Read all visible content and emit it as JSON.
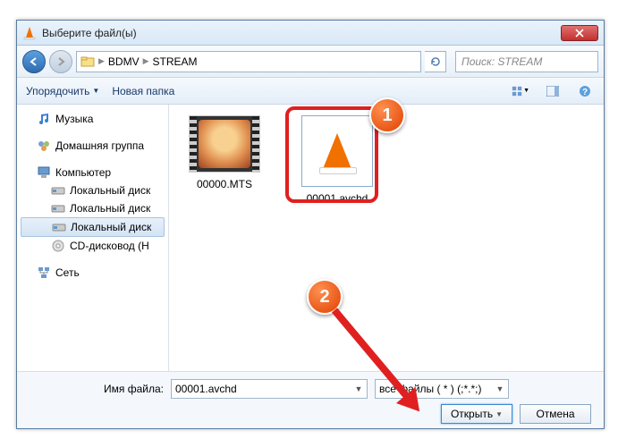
{
  "window": {
    "title": "Выберите файл(ы)"
  },
  "nav": {
    "crumbs": [
      "BDMV",
      "STREAM"
    ],
    "search_placeholder": "Поиск: STREAM"
  },
  "toolbar": {
    "organize": "Упорядочить",
    "newfolder": "Новая папка"
  },
  "sidebar": {
    "music": "Музыка",
    "homegroup": "Домашняя группа",
    "computer": "Компьютер",
    "disk1": "Локальный диск",
    "disk2": "Локальный диск",
    "disk3": "Локальный диск",
    "cdrom": "CD-дисковод (H",
    "network": "Сеть"
  },
  "files": {
    "f1": "00000.MTS",
    "f2": "00001.avchd"
  },
  "footer": {
    "filename_label": "Имя файла:",
    "filename_value": "00001.avchd",
    "filetype": "все файлы ( * ) (;*.*;)",
    "open": "Открыть",
    "cancel": "Отмена"
  },
  "badges": {
    "b1": "1",
    "b2": "2"
  }
}
